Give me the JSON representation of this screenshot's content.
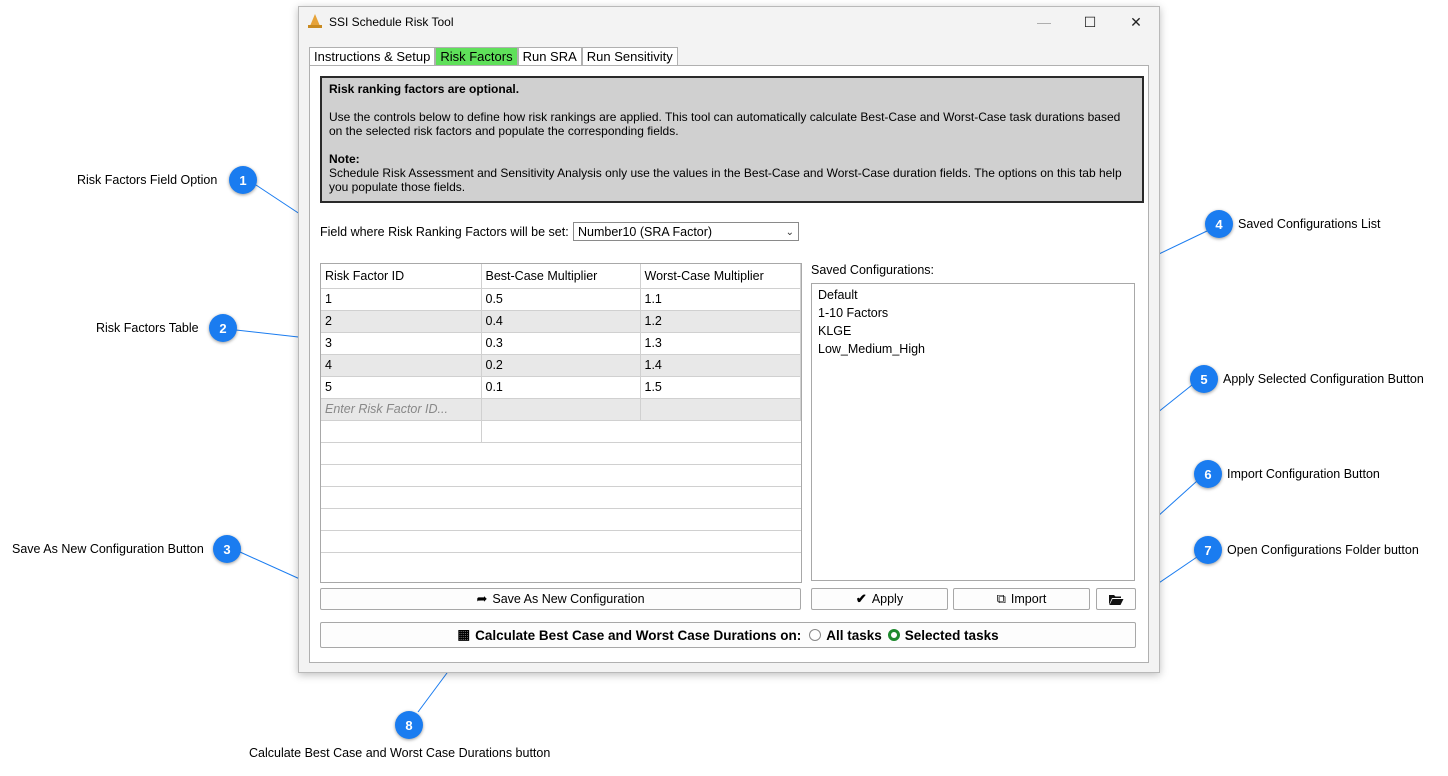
{
  "window": {
    "title": "SSI Schedule Risk Tool",
    "controls": {
      "minimize": "—",
      "maximize": "☐",
      "close": "✕"
    }
  },
  "tabs": [
    {
      "label": "Instructions & Setup",
      "active": false
    },
    {
      "label": "Risk Factors",
      "active": true
    },
    {
      "label": "Run SRA",
      "active": false
    },
    {
      "label": "Run Sensitivity",
      "active": false
    }
  ],
  "info": {
    "heading": "Risk ranking factors are optional.",
    "body": "Use the controls below to define how risk rankings are applied. This tool can automatically calculate Best-Case and Worst-Case task durations based on the selected risk factors and populate the corresponding fields.",
    "note_label": "Note:",
    "note_body": "Schedule Risk Assessment and Sensitivity Analysis only use the values in the Best-Case and Worst-Case duration fields. The options on this tab help you populate those fields."
  },
  "field_select": {
    "label": "Field where Risk Ranking Factors will be set:",
    "value": "Number10 (SRA Factor)"
  },
  "table": {
    "headers": [
      "Risk Factor ID",
      "Best-Case Multiplier",
      "Worst-Case Multiplier"
    ],
    "rows": [
      [
        "1",
        "0.5",
        "1.1"
      ],
      [
        "2",
        "0.4",
        "1.2"
      ],
      [
        "3",
        "0.3",
        "1.3"
      ],
      [
        "4",
        "0.2",
        "1.4"
      ],
      [
        "5",
        "0.1",
        "1.5"
      ]
    ],
    "new_row_placeholder": "Enter Risk Factor ID..."
  },
  "saved": {
    "label": "Saved Configurations:",
    "items": [
      "Default",
      "1-10 Factors",
      "KLGE",
      "Low_Medium_High"
    ]
  },
  "buttons": {
    "save_new": "Save As New Configuration",
    "apply": "Apply",
    "import": "Import"
  },
  "calc": {
    "label": "Calculate Best Case and Worst Case Durations on:",
    "option_all": "All tasks",
    "option_selected": "Selected tasks",
    "selected": "Selected tasks"
  },
  "annotations": [
    {
      "n": "1",
      "text": "Risk Factors Field Option"
    },
    {
      "n": "2",
      "text": "Risk Factors Table"
    },
    {
      "n": "3",
      "text": "Save As New Configuration Button"
    },
    {
      "n": "4",
      "text": "Saved Configurations List"
    },
    {
      "n": "5",
      "text": "Apply Selected Configuration Button"
    },
    {
      "n": "6",
      "text": "Import Configuration Button"
    },
    {
      "n": "7",
      "text": "Open Configurations Folder button"
    },
    {
      "n": "8",
      "text": "Calculate Best Case and Worst Case Durations button"
    }
  ],
  "colors": {
    "badge": "#1a7cf0",
    "active_tab": "#5fe05a",
    "radio_on": "#1e8a2e"
  }
}
